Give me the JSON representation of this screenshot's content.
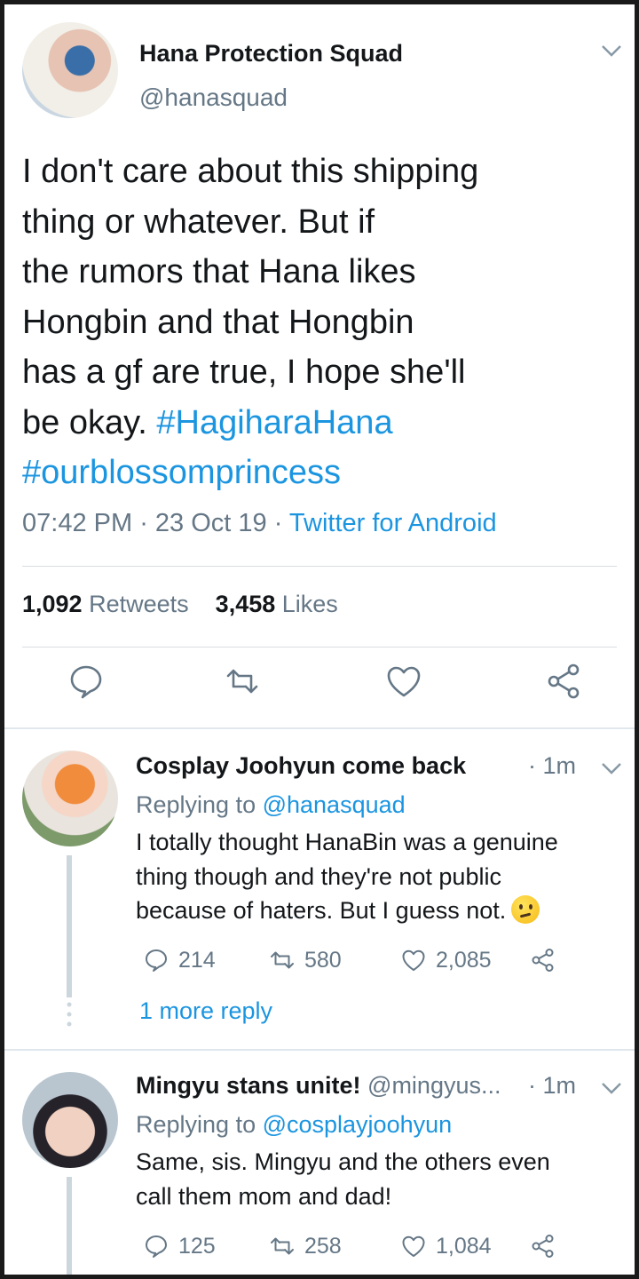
{
  "main_tweet": {
    "display_name": "Hana Protection Squad",
    "handle": "@hanasquad",
    "text_lines": [
      "I don't care about this shipping",
      "thing or whatever. But if",
      "the rumors that Hana likes",
      "Hongbin and that Hongbin",
      "has a gf are true, I hope she'll"
    ],
    "text_last_plain": "be okay. ",
    "hashtag_1": "#HagiharaHana",
    "hashtag_2": "#ourblossomprincess",
    "time": "07:42 PM",
    "date": "23 Oct 19",
    "source": "Twitter for Android",
    "retweet_count": "1,092",
    "retweet_label": "Retweets",
    "like_count": "3,458",
    "like_label": "Likes"
  },
  "replies": [
    {
      "display_name": "Cosplay Joohyun come back",
      "handle": "",
      "time": "1m",
      "replying_prefix": "Replying to ",
      "replying_to": "@hanasquad",
      "text_lines": [
        "I totally thought HanaBin was a genuine",
        "thing though and they're not public",
        "because of haters. But I guess not."
      ],
      "emoji": "confused-face",
      "reply_count": "214",
      "retweet_count": "580",
      "like_count": "2,085",
      "more_replies": "1 more reply"
    },
    {
      "display_name": "Mingyu stans unite!",
      "handle": "@mingyus...",
      "time": "1m",
      "replying_prefix": "Replying to ",
      "replying_to": "@cosplayjoohyun",
      "text_lines": [
        "Same, sis. Mingyu and the others even",
        "call them mom and dad!"
      ],
      "reply_count": "125",
      "retweet_count": "258",
      "like_count": "1,084"
    }
  ],
  "colors": {
    "link": "#1b95e0",
    "secondary_text": "#657786",
    "primary_text": "#14171a",
    "divider": "#e1e8ed"
  },
  "icons": [
    "chevron-down-icon",
    "reply-icon",
    "retweet-icon",
    "like-icon",
    "share-icon"
  ]
}
